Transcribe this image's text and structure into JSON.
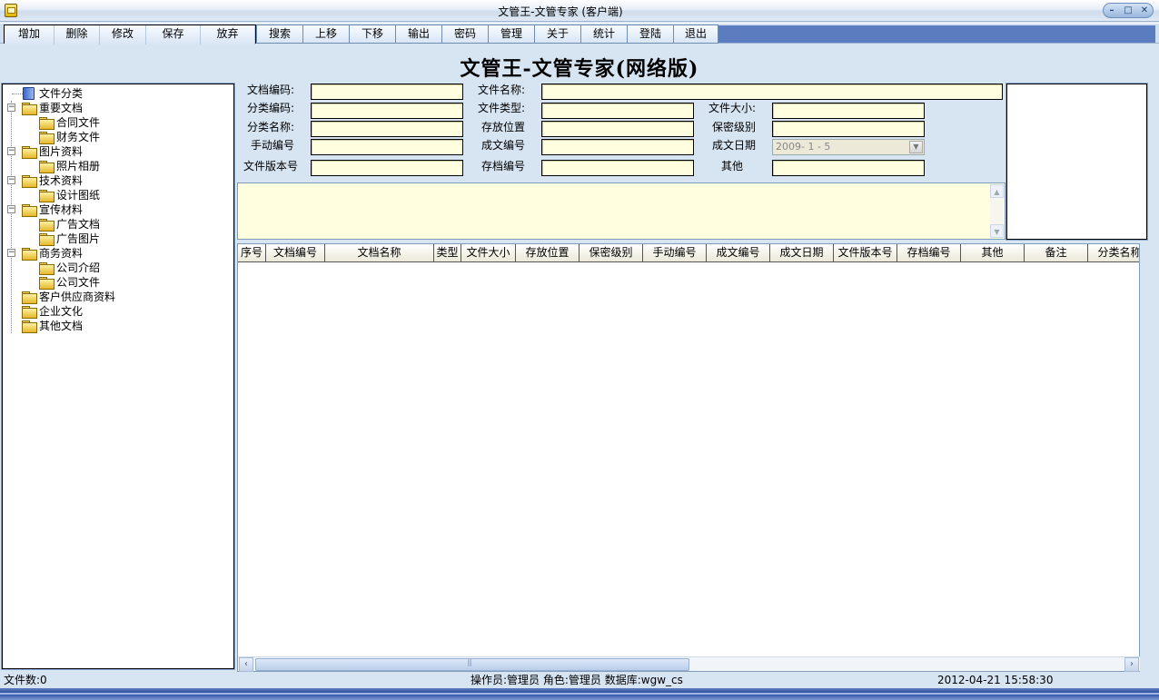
{
  "window": {
    "title": "文管王-文管专家 (客户端)"
  },
  "toolbar": {
    "buttons": [
      {
        "label": "增加"
      },
      {
        "label": "删除"
      },
      {
        "label": "修改"
      },
      {
        "label": "保存"
      },
      {
        "label": "放弃"
      },
      {
        "label": "搜索"
      },
      {
        "label": "上移"
      },
      {
        "label": "下移"
      },
      {
        "label": "输出"
      },
      {
        "label": "密码"
      },
      {
        "label": "管理"
      },
      {
        "label": "关于"
      },
      {
        "label": "统计"
      },
      {
        "label": "登陆"
      },
      {
        "label": "退出"
      }
    ]
  },
  "heading": "文管王-文管专家(网络版)",
  "tree": {
    "root": "文件分类",
    "items": [
      {
        "label": "重要文档",
        "expanded": true,
        "children": [
          "合同文件",
          "财务文件"
        ]
      },
      {
        "label": "图片资料",
        "expanded": true,
        "children": [
          "照片相册"
        ]
      },
      {
        "label": "技术资料",
        "expanded": true,
        "children": [
          "设计图纸"
        ]
      },
      {
        "label": "宣传材料",
        "expanded": true,
        "children": [
          "广告文档",
          "广告图片"
        ]
      },
      {
        "label": "商务资料",
        "expanded": true,
        "children": [
          "公司介绍",
          "公司文件"
        ]
      },
      {
        "label": "客户供应商资料",
        "expanded": false,
        "children": []
      },
      {
        "label": "企业文化",
        "expanded": false,
        "children": []
      },
      {
        "label": "其他文档",
        "expanded": false,
        "children": []
      }
    ]
  },
  "form": {
    "doc_code": {
      "label": "文档编码:",
      "value": ""
    },
    "file_name": {
      "label": "文件名称:",
      "value": ""
    },
    "category_code": {
      "label": "分类编码:",
      "value": ""
    },
    "file_type": {
      "label": "文件类型:",
      "value": ""
    },
    "file_size": {
      "label": "文件大小:",
      "value": ""
    },
    "category_name": {
      "label": "分类名称:",
      "value": ""
    },
    "location": {
      "label": "存放位置",
      "value": ""
    },
    "secrecy": {
      "label": "保密级别",
      "value": ""
    },
    "manual_no": {
      "label": "手动编号",
      "value": ""
    },
    "issue_no": {
      "label": "成文编号",
      "value": ""
    },
    "issue_date": {
      "label": "成文日期",
      "value": "2009- 1 - 5"
    },
    "version_no": {
      "label": "文件版本号",
      "value": ""
    },
    "archive_no": {
      "label": "存档编号",
      "value": ""
    },
    "other": {
      "label": "其他",
      "value": ""
    }
  },
  "grid": {
    "columns": [
      "序号",
      "文档编号",
      "文档名称",
      "类型",
      "文件大小",
      "存放位置",
      "保密级别",
      "手动编号",
      "成文编号",
      "成文日期",
      "文件版本号",
      "存档编号",
      "其他",
      "备注",
      "分类名称"
    ],
    "rows": []
  },
  "status": {
    "file_count": "文件数:0",
    "operator": "操作员:管理员 角色:管理员 数据库:wgw_cs",
    "datetime": "2012-04-21 15:58:30"
  }
}
